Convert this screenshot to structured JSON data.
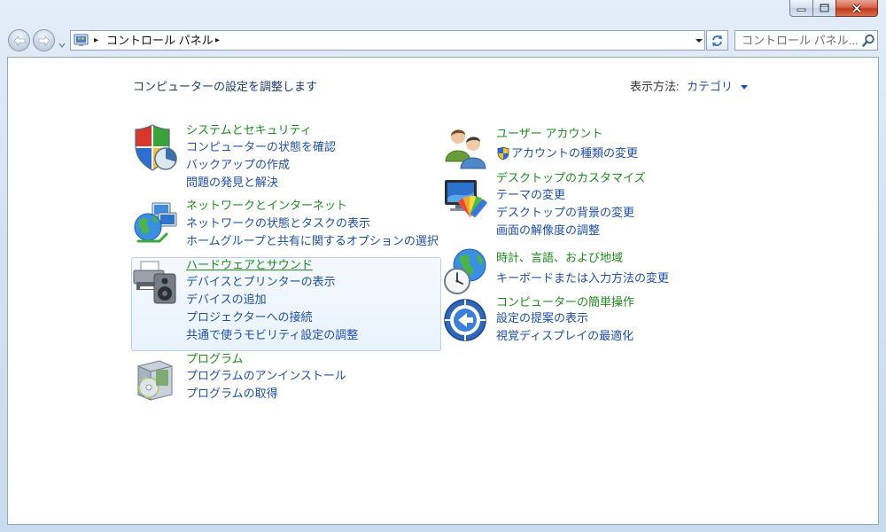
{
  "window_controls": {
    "minimize_icon": "minimize-icon",
    "maximize_icon": "maximize-icon",
    "close_icon": "close-icon"
  },
  "nav": {
    "back_icon": "back-arrow-icon",
    "forward_icon": "forward-arrow-icon",
    "recent_pages_icon": "chevron-down-icon"
  },
  "address_bar": {
    "location_icon": "control-panel-icon",
    "separator": "▸",
    "segments": [
      "コントロール パネル"
    ],
    "dropdown_icon": "chevron-down-icon",
    "refresh_icon": "refresh-icon"
  },
  "search": {
    "placeholder": "コントロール パネル...",
    "icon": "search-icon"
  },
  "header": {
    "title": "コンピューターの設定を調整します",
    "view_by_label": "表示方法:",
    "view_by_value": "カテゴリ"
  },
  "colors": {
    "category_title": "#1e8a1e",
    "link": "#1f4fa6",
    "highlight_box": "#e9f2fc",
    "close_button": "#c3391c"
  },
  "categories": {
    "left": [
      {
        "icon": "security-shield-icon",
        "title": "システムとセキュリティ",
        "links": [
          "コンピューターの状態を確認",
          "バックアップの作成",
          "問題の発見と解決"
        ]
      },
      {
        "icon": "network-globe-icon",
        "title": "ネットワークとインターネット",
        "links": [
          "ネットワークの状態とタスクの表示",
          "ホームグループと共有に関するオプションの選択"
        ]
      },
      {
        "icon": "printer-speaker-icon",
        "title": "ハードウェアとサウンド",
        "highlighted": true,
        "links": [
          "デバイスとプリンターの表示",
          "デバイスの追加",
          "プロジェクターへの接続",
          "共通で使うモビリティ設定の調整"
        ]
      },
      {
        "icon": "programs-box-icon",
        "title": "プログラム",
        "links": [
          "プログラムのアンインストール",
          "プログラムの取得"
        ]
      }
    ],
    "right": [
      {
        "icon": "user-accounts-icon",
        "title": "ユーザー アカウント",
        "links": [
          "アカウントの種類の変更"
        ],
        "link_icons": [
          "uac-shield-icon"
        ]
      },
      {
        "icon": "desktop-palette-icon",
        "title": "デスクトップのカスタマイズ",
        "links": [
          "テーマの変更",
          "デスクトップの背景の変更",
          "画面の解像度の調整"
        ]
      },
      {
        "icon": "clock-globe-icon",
        "title": "時計、言語、および地域",
        "links": [
          "キーボードまたは入力方法の変更"
        ]
      },
      {
        "icon": "ease-of-access-icon",
        "title": "コンピューターの簡単操作",
        "links": [
          "設定の提案の表示",
          "視覚ディスプレイの最適化"
        ]
      }
    ]
  }
}
